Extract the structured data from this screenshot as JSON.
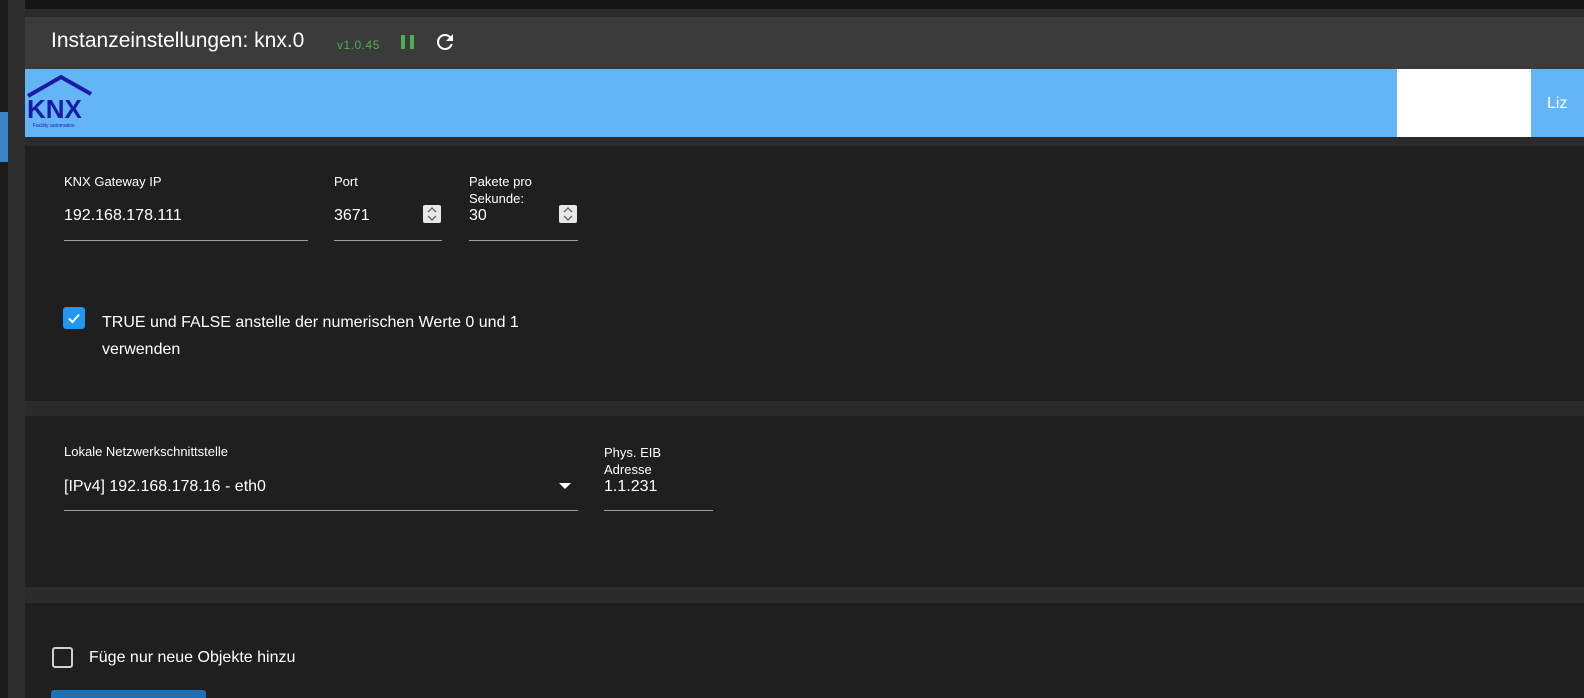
{
  "window": {
    "title": "Instanzeinstellungen: knx.0",
    "version": "v1.0.45"
  },
  "toolbar": {
    "pause_icon": "pause-icon",
    "reload_icon": "reload-icon"
  },
  "header": {
    "logo_text": "KNX",
    "logo_subtext": "Facility automation",
    "license_tab_label": "Liz"
  },
  "connection": {
    "gateway_ip": {
      "label": "KNX Gateway IP",
      "value": "192.168.178.111"
    },
    "port": {
      "label": "Port",
      "value": "3671"
    },
    "packets_per_second": {
      "label_line1": "Pakete pro",
      "label_line2": "Sekunde:",
      "value": "30"
    },
    "use_true_false": {
      "checked": true,
      "label_line1": "TRUE und FALSE anstelle der numerischen Werte 0 und 1",
      "label_line2": "verwenden"
    }
  },
  "network": {
    "local_interface": {
      "label": "Lokale Netzwerkschnittstelle",
      "value": "[IPv4] 192.168.178.16 - eth0"
    },
    "phys_eib_address": {
      "label_line1": "Phys. EIB",
      "label_line2": "Adresse",
      "value": "1.1.231"
    }
  },
  "import": {
    "add_only_new": {
      "checked": false,
      "label": "Füge nur neue Objekte hinzu"
    }
  },
  "colors": {
    "accent": "#2196f3",
    "header_band": "#64b5f6",
    "status_green": "#4caf50",
    "panel_bg": "#1f1f1f",
    "page_bg": "#2b2b2b"
  }
}
